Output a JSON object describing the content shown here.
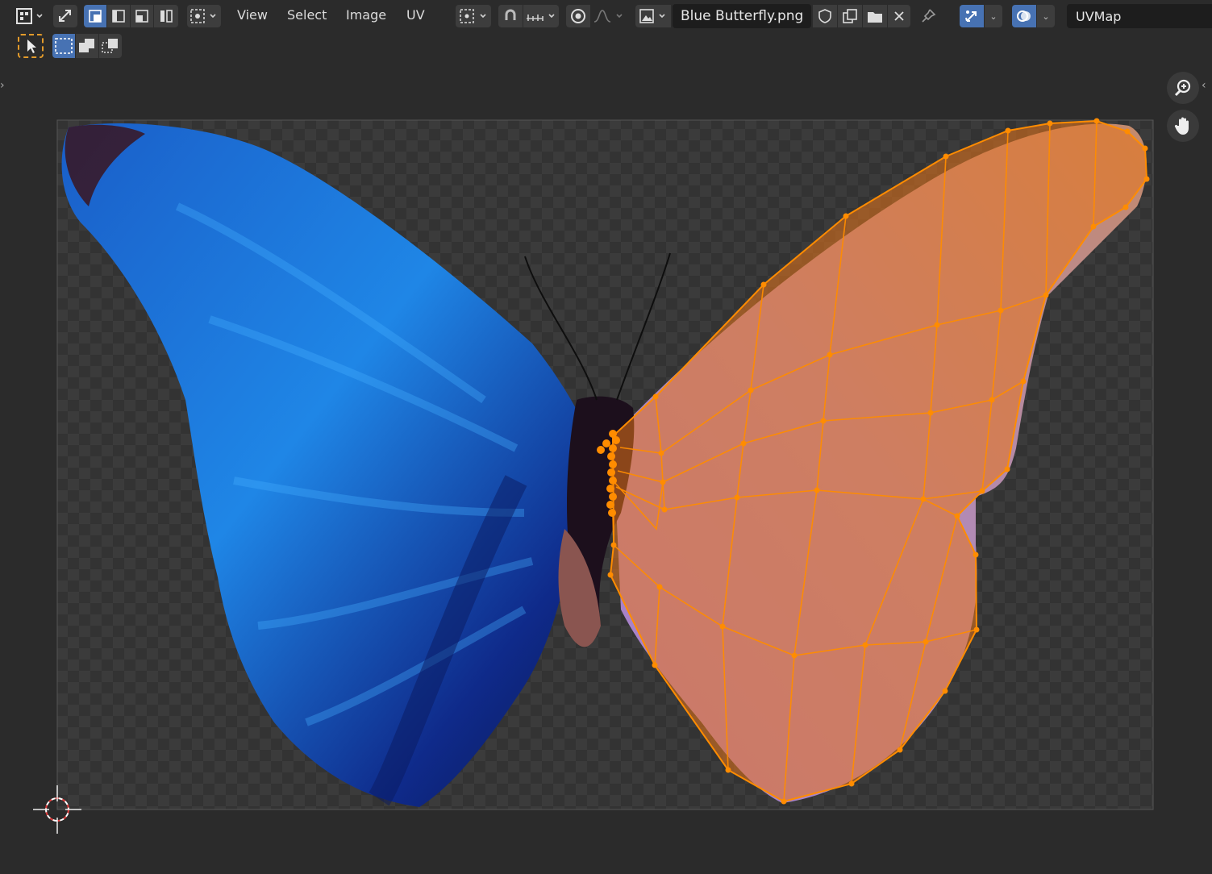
{
  "header": {
    "menus": [
      "View",
      "Select",
      "Image",
      "UV"
    ],
    "image_name": "Blue Butterfly.png",
    "uv_map": "UVMap"
  },
  "icons": {
    "editor_type": "uv-editor-icon",
    "sync": "sync-selection-icon",
    "select_modes": [
      "vertex-select-icon",
      "edge-select-icon",
      "face-select-icon",
      "island-select-icon"
    ],
    "sticky": "sticky-select-icon",
    "pivot": "pivot-point-icon",
    "snap": "snap-icon",
    "snap_increment": "snap-increment-icon",
    "proportional": "proportional-edit-icon",
    "falloff": "falloff-curve-icon",
    "image_browse": "image-browse-icon",
    "fake_user": "fake-user-shield-icon",
    "duplicate": "duplicate-image-icon",
    "open": "open-folder-icon",
    "unlink": "unlink-x-icon",
    "pin": "pin-icon",
    "gizmo": "gizmo-icon",
    "overlay": "overlay-icon",
    "zoom": "zoom-icon",
    "pan": "hand-pan-icon"
  },
  "colors": {
    "editor_bg": "#2b2b2b",
    "accent_blue": "#4772b3",
    "uv_selection": "#ff8c00",
    "uv_face_fill": "#e8751a"
  },
  "uv_selection_state": "right wing selected"
}
